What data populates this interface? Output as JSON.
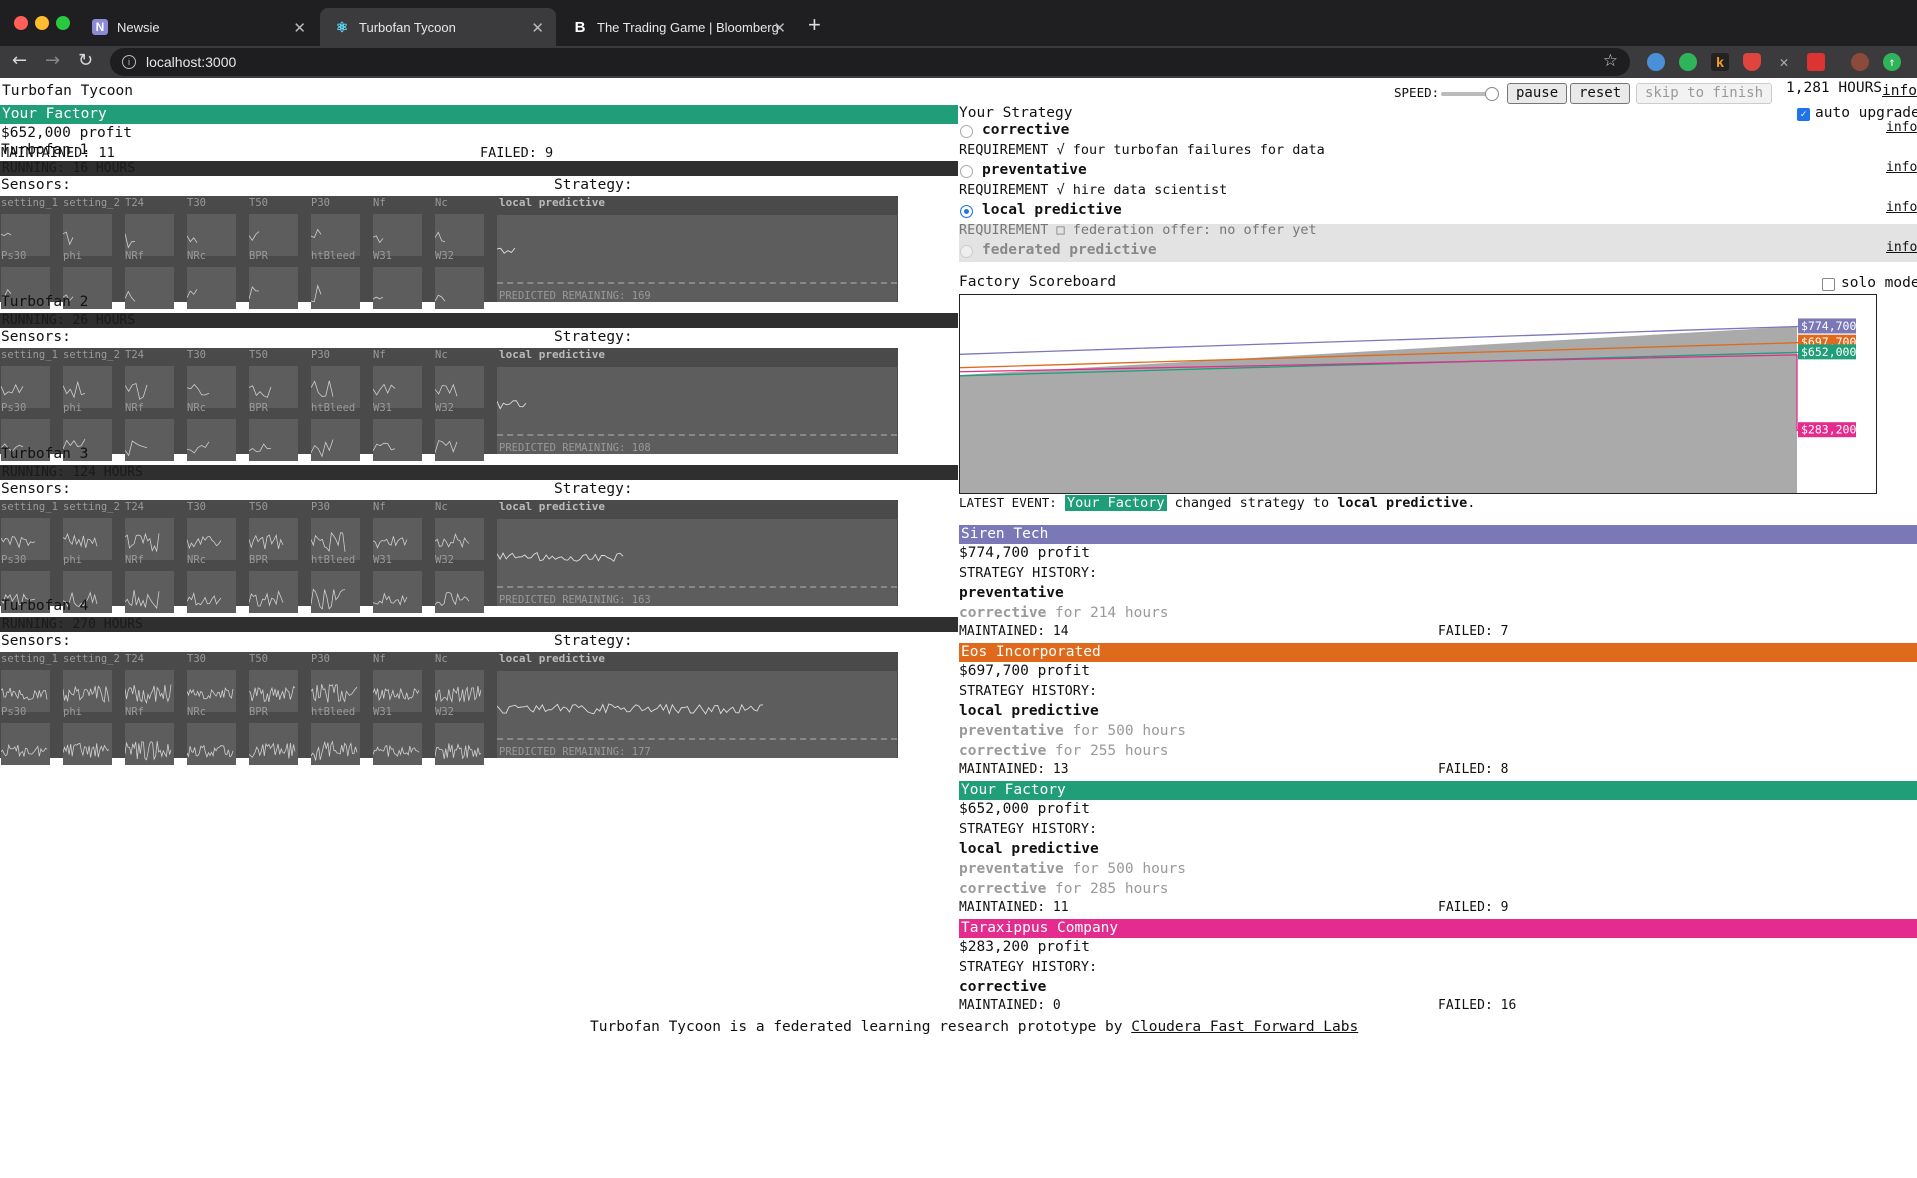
{
  "browser": {
    "tabs": [
      {
        "title": "Newsie",
        "favicon": "N"
      },
      {
        "title": "Turbofan Tycoon",
        "favicon": "react-icon"
      },
      {
        "title": "The Trading Game | Bloomberg",
        "favicon": "B"
      }
    ],
    "url": "localhost:3000"
  },
  "app": {
    "title": "Turbofan Tycoon",
    "speed_label": "SPEED:",
    "pause_label": "pause",
    "reset_label": "reset",
    "skip_label": "skip to finish",
    "hours": "1,281 HOURS",
    "info_link": "info"
  },
  "factory": {
    "name": "Your Factory",
    "profit": "$652,000 profit",
    "maintained": "MAINTAINED: 11",
    "failed": "FAILED: 9",
    "sensors_label": "Sensors:",
    "strategy_label": "Strategy:",
    "sensor_names_row1": [
      "setting_1",
      "setting_2",
      "T24",
      "T30",
      "T50",
      "P30",
      "Nf",
      "Nc"
    ],
    "sensor_names_row2": [
      "Ps30",
      "phi",
      "NRf",
      "NRc",
      "BPR",
      "htBleed",
      "W31",
      "W32"
    ],
    "turbofans": [
      {
        "name": "Turbofan 1",
        "running": "RUNNING: 16 HOURS",
        "strategy": "local predictive",
        "remaining": "PREDICTED REMAINING: 169",
        "level": 0.05
      },
      {
        "name": "Turbofan 2",
        "running": "RUNNING: 26 HOURS",
        "strategy": "local predictive",
        "remaining": "PREDICTED REMAINING: 108",
        "level": 0.08
      },
      {
        "name": "Turbofan 3",
        "running": "RUNNING: 124 HOURS",
        "strategy": "local predictive",
        "remaining": "PREDICTED REMAINING: 163",
        "level": 0.35
      },
      {
        "name": "Turbofan 4",
        "running": "RUNNING: 270 HOURS",
        "strategy": "local predictive",
        "remaining": "PREDICTED REMAINING: 177",
        "level": 0.74
      }
    ]
  },
  "strategy": {
    "heading": "Your Strategy",
    "auto_upgrade": "auto upgrade",
    "options": [
      {
        "name": "corrective",
        "requirement": "REQUIREMENT √ four turbofan failures for data",
        "selected": false,
        "disabled": false
      },
      {
        "name": "preventative",
        "requirement": "REQUIREMENT √ hire data scientist",
        "selected": false,
        "disabled": false
      },
      {
        "name": "local predictive",
        "requirement": "REQUIREMENT □ federation offer: no offer yet",
        "selected": true,
        "disabled": false
      },
      {
        "name": "federated predictive",
        "requirement": "",
        "selected": false,
        "disabled": true
      }
    ]
  },
  "scoreboard": {
    "title": "Factory Scoreboard",
    "solo_mode": "solo mode",
    "latest_event_label": "LATEST EVENT:",
    "latest_event_who": "Your Factory",
    "latest_event_text": " changed strategy to ",
    "latest_event_strategy": "local predictive",
    "latest_event_end": "."
  },
  "chart_data": {
    "type": "line",
    "title": "Factory Scoreboard",
    "xlabel": "",
    "ylabel": "",
    "series": [
      {
        "name": "Siren Tech",
        "color": "#7b78b8",
        "final_label": "$774,700",
        "final": 774700
      },
      {
        "name": "Eos Incorporated",
        "color": "#e06a1c",
        "final_label": "$697,700",
        "final": 697700
      },
      {
        "name": "Your Factory",
        "color": "#1f9e77",
        "final_label": "$652,000",
        "final": 652000
      },
      {
        "name": "Taraxippus Company",
        "color": "#e32c8e",
        "final_label": "$283,200",
        "final": 283200
      }
    ]
  },
  "companies": [
    {
      "name": "Siren Tech",
      "color": "#7b78b8",
      "profit": "$774,700 profit",
      "history_label": "STRATEGY HISTORY:",
      "current": "preventative",
      "past": [
        {
          "name": "corrective",
          "duration": " for 214 hours"
        }
      ],
      "maintained": "MAINTAINED: 14",
      "failed": "FAILED: 7"
    },
    {
      "name": "Eos Incorporated",
      "color": "#e06a1c",
      "profit": "$697,700 profit",
      "history_label": "STRATEGY HISTORY:",
      "current": "local predictive",
      "past": [
        {
          "name": "preventative",
          "duration": " for 500 hours"
        },
        {
          "name": "corrective",
          "duration": " for 255 hours"
        }
      ],
      "maintained": "MAINTAINED: 13",
      "failed": "FAILED: 8"
    },
    {
      "name": "Your Factory",
      "color": "#1f9e77",
      "profit": "$652,000 profit",
      "history_label": "STRATEGY HISTORY:",
      "current": "local predictive",
      "past": [
        {
          "name": "preventative",
          "duration": " for 500 hours"
        },
        {
          "name": "corrective",
          "duration": " for 285 hours"
        }
      ],
      "maintained": "MAINTAINED: 11",
      "failed": "FAILED: 9"
    },
    {
      "name": "Taraxippus Company",
      "color": "#e32c8e",
      "profit": "$283,200 profit",
      "history_label": "STRATEGY HISTORY:",
      "current": "corrective",
      "past": [],
      "maintained": "MAINTAINED: 0",
      "failed": "FAILED: 16"
    }
  ],
  "footer": {
    "text": "Turbofan Tycoon is a federated learning research prototype by ",
    "link": "Cloudera Fast Forward Labs"
  },
  "colors": {
    "green": "#1f9e77",
    "purple": "#7b78b8",
    "orange": "#e06a1c",
    "pink": "#e32c8e"
  }
}
